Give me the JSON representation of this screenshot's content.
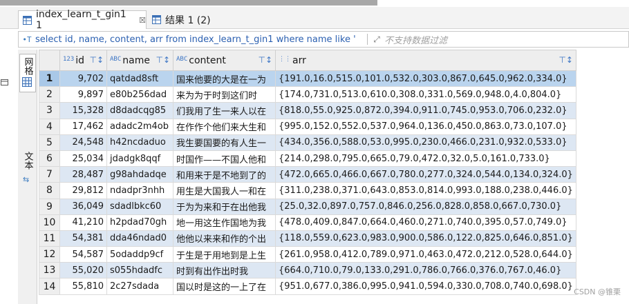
{
  "tabs": [
    {
      "label": "index_learn_t_gin1 1",
      "close": "☒"
    },
    {
      "label": "结果 1 (2)"
    }
  ],
  "sqlbar": {
    "filter_icon": "•T",
    "sql": "select id, name, content, arr from index_learn_t_gin1 where name like '",
    "placeholder": "不支持数据过滤"
  },
  "side": {
    "grid_label": "网格",
    "text_label": "文本"
  },
  "columns": [
    {
      "type": "123",
      "name": "id"
    },
    {
      "type": "ABC",
      "name": "name"
    },
    {
      "type": "ABC",
      "name": "content"
    },
    {
      "type": "",
      "name": "arr"
    }
  ],
  "rows": [
    {
      "n": "1",
      "id": "9,702",
      "name": "qatdad8sft",
      "content": "国来他要的大是在一为",
      "arr": "{191.0,16.0,515.0,101.0,532.0,303.0,867.0,645.0,962.0,334.0}"
    },
    {
      "n": "2",
      "id": "9,897",
      "name": "e80b256dad",
      "content": "来为为于时到这们时",
      "arr": "{174.0,731.0,513.0,610.0,308.0,331.0,569.0,948.0,4.0,804.0}"
    },
    {
      "n": "3",
      "id": "15,328",
      "name": "d8dadcqg85",
      "content": "们我用了生一来人以在",
      "arr": "{818.0,55.0,925.0,872.0,394.0,911.0,745.0,953.0,706.0,232.0}"
    },
    {
      "n": "4",
      "id": "17,462",
      "name": "adadc2m4ob",
      "content": "在作作个他们来大生和",
      "arr": "{995.0,152.0,552.0,537.0,964.0,136.0,450.0,863.0,73.0,107.0}"
    },
    {
      "n": "5",
      "id": "24,548",
      "name": "h42ncdaduo",
      "content": "我生要国要的有人生一",
      "arr": "{434.0,356.0,588.0,53.0,995.0,230.0,466.0,231.0,932.0,533.0}"
    },
    {
      "n": "6",
      "id": "25,034",
      "name": "jdadgk8qqf",
      "content": "时国作——不国人他和",
      "arr": "{214.0,298.0,795.0,665.0,79.0,472.0,32.0,5.0,161.0,733.0}"
    },
    {
      "n": "7",
      "id": "28,487",
      "name": "g98ahdadqe",
      "content": "和用来于是不地到了的",
      "arr": "{472.0,665.0,466.0,667.0,780.0,277.0,324.0,544.0,134.0,324.0}"
    },
    {
      "n": "8",
      "id": "29,812",
      "name": "ndadpr3nhh",
      "content": "用生是大国我人一和在",
      "arr": "{311.0,238.0,371.0,643.0,853.0,814.0,993.0,188.0,238.0,446.0}"
    },
    {
      "n": "9",
      "id": "36,049",
      "name": "sdadlbkc60",
      "content": "于为为来和于在出他我",
      "arr": "{25.0,32.0,897.0,757.0,846.0,256.0,828.0,858.0,667.0,730.0}"
    },
    {
      "n": "10",
      "id": "41,210",
      "name": "h2pdad70gh",
      "content": "地一用这生作国地为我",
      "arr": "{478.0,409.0,847.0,664.0,460.0,271.0,740.0,395.0,57.0,749.0}"
    },
    {
      "n": "11",
      "id": "54,381",
      "name": "dda46ndad0",
      "content": "他他以来来和作的个出",
      "arr": "{118.0,559.0,623.0,983.0,900.0,586.0,122.0,825.0,646.0,851.0}"
    },
    {
      "n": "12",
      "id": "54,587",
      "name": "5odaddp9cf",
      "content": "于生是于用地到是上生",
      "arr": "{261.0,958.0,412.0,789.0,971.0,463.0,472.0,212.0,528.0,644.0}"
    },
    {
      "n": "13",
      "id": "55,020",
      "name": "s055hdadfc",
      "content": "时到有出作出时我",
      "arr": "{664.0,710.0,79.0,133.0,291.0,786.0,766.0,376.0,767.0,46.0}"
    },
    {
      "n": "14",
      "id": "55,810",
      "name": "2c27sdada",
      "content": "国以时是这的一上了在",
      "arr": "{951.0,677.0,386.0,995.0,941.0,594.0,330.0,708.0,740.0,698.0}"
    }
  ],
  "watermark": "CSDN @锥栗"
}
